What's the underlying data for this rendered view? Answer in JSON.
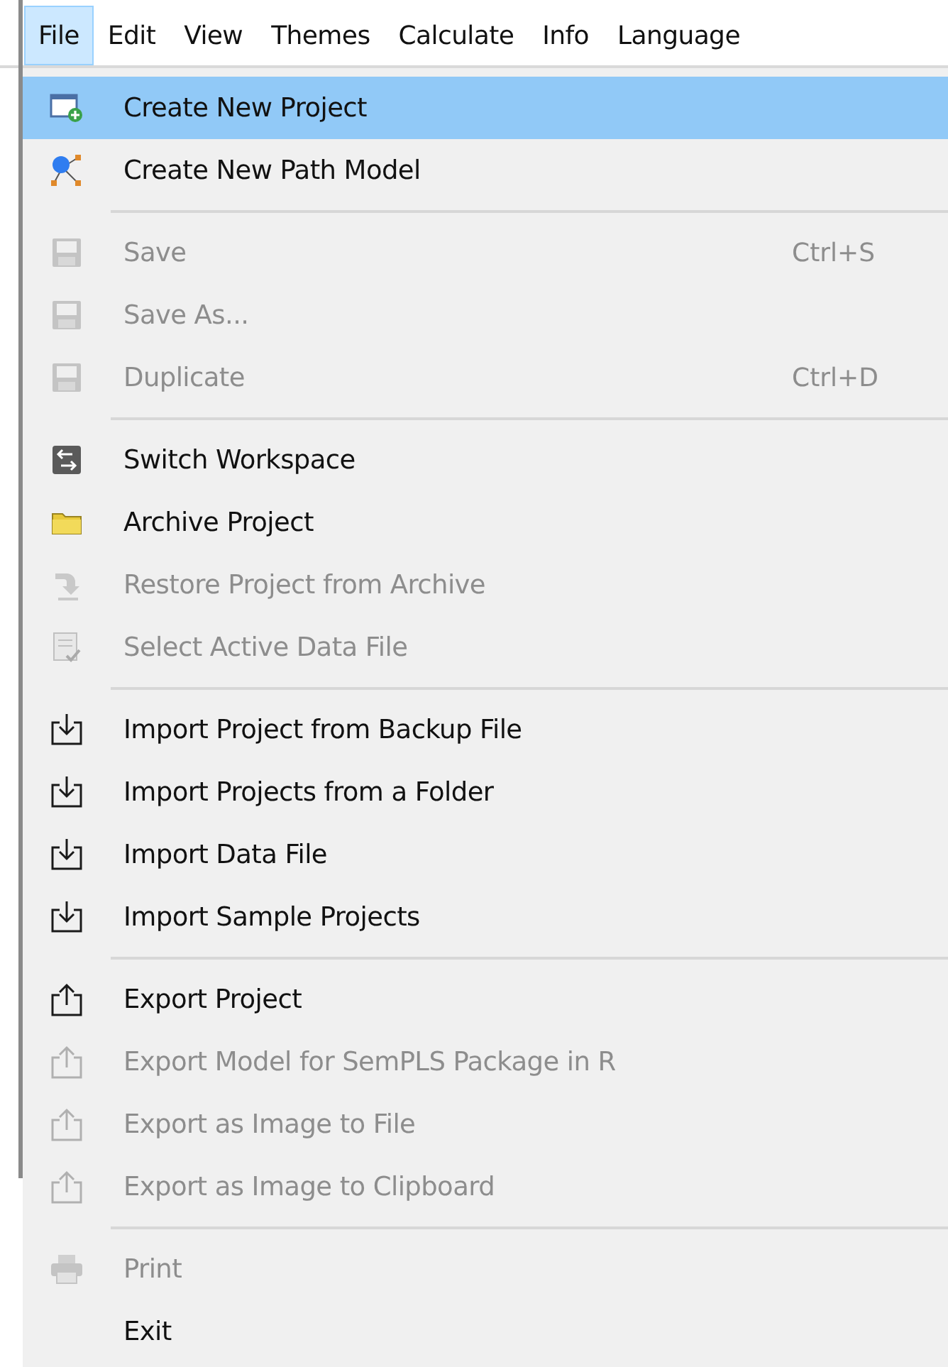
{
  "menubar": [
    {
      "label": "File",
      "selected": true
    },
    {
      "label": "Edit",
      "selected": false
    },
    {
      "label": "View",
      "selected": false
    },
    {
      "label": "Themes",
      "selected": false
    },
    {
      "label": "Calculate",
      "selected": false
    },
    {
      "label": "Info",
      "selected": false
    },
    {
      "label": "Language",
      "selected": false
    }
  ],
  "menu": {
    "sections": [
      {
        "items": [
          {
            "label": "Create New Project",
            "disabled": false,
            "selected": true
          },
          {
            "label": "Create New Path Model",
            "disabled": false,
            "selected": false
          }
        ]
      },
      {
        "items": [
          {
            "label": "Save",
            "shortcut": "Ctrl+S",
            "disabled": true,
            "selected": false
          },
          {
            "label": "Save As...",
            "disabled": true,
            "selected": false
          },
          {
            "label": "Duplicate",
            "shortcut": "Ctrl+D",
            "disabled": true,
            "selected": false
          }
        ]
      },
      {
        "items": [
          {
            "label": "Switch Workspace",
            "disabled": false,
            "selected": false
          },
          {
            "label": "Archive Project",
            "disabled": false,
            "selected": false
          },
          {
            "label": "Restore Project from Archive",
            "disabled": true,
            "selected": false
          },
          {
            "label": "Select Active Data File",
            "disabled": true,
            "selected": false
          }
        ]
      },
      {
        "items": [
          {
            "label": "Import Project from Backup File",
            "disabled": false,
            "selected": false
          },
          {
            "label": "Import Projects from a Folder",
            "disabled": false,
            "selected": false
          },
          {
            "label": "Import Data File",
            "disabled": false,
            "selected": false
          },
          {
            "label": "Import Sample Projects",
            "disabled": false,
            "selected": false
          }
        ]
      },
      {
        "items": [
          {
            "label": "Export Project",
            "disabled": false,
            "selected": false
          },
          {
            "label": "Export Model for SemPLS Package in R",
            "disabled": true,
            "selected": false
          },
          {
            "label": "Export as Image to File",
            "disabled": true,
            "selected": false
          },
          {
            "label": "Export as Image to Clipboard",
            "disabled": true,
            "selected": false
          }
        ]
      },
      {
        "items": [
          {
            "label": "Print",
            "disabled": true,
            "selected": false
          },
          {
            "label": "Exit",
            "disabled": false,
            "selected": false
          }
        ]
      }
    ]
  }
}
